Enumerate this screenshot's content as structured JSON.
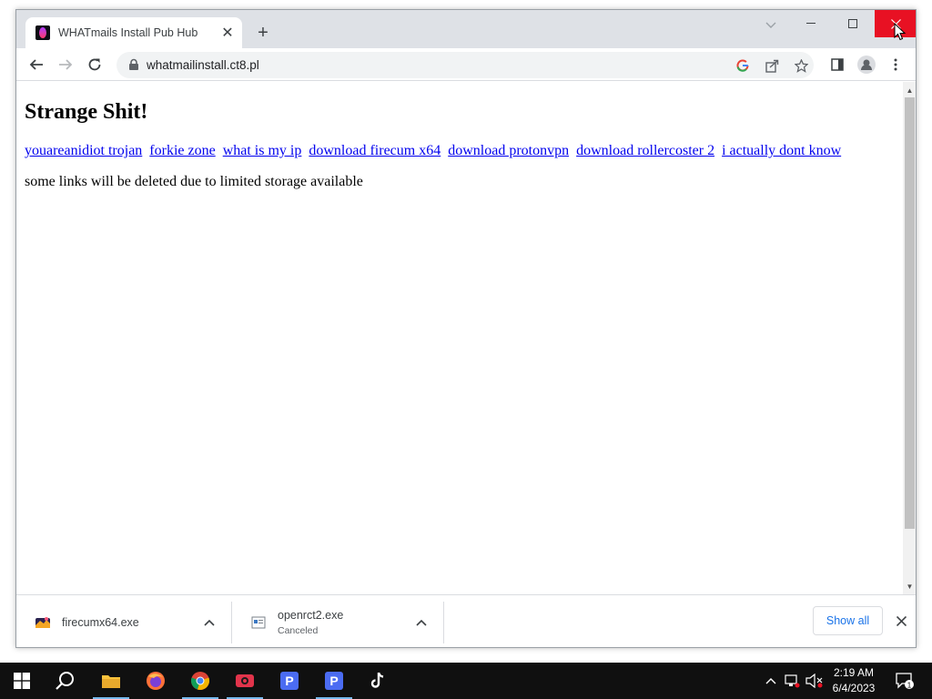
{
  "browser": {
    "tab": {
      "title": "WHATmails Install Pub Hub",
      "close_glyph": "✕"
    },
    "new_tab_glyph": "+",
    "url": "whatmailinstall.ct8.pl"
  },
  "page": {
    "heading": "Strange Shit!",
    "links": [
      "youareanidiot trojan",
      "forkie zone",
      "what is my ip",
      "download firecum x64",
      "download protonvpn",
      "download rollercoster 2",
      "i actually dont know"
    ],
    "note": "some links will be deleted due to limited storage available"
  },
  "downloads": {
    "items": [
      {
        "name": "firecumx64.exe",
        "status": ""
      },
      {
        "name": "openrct2.exe",
        "status": "Canceled"
      }
    ],
    "show_all_label": "Show all"
  },
  "taskbar": {
    "time": "2:19 AM",
    "date": "6/4/2023",
    "notification_count": "1"
  },
  "colors": {
    "close_button": "#e81123",
    "link": "#0000ee",
    "accent": "#1a73e8"
  }
}
